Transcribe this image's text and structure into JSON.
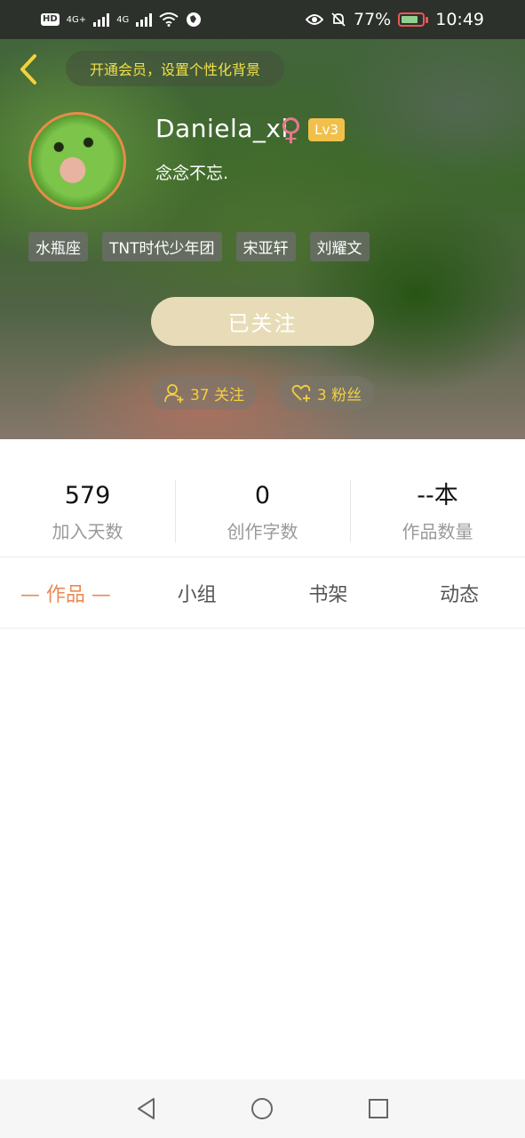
{
  "status_bar": {
    "hd_label": "HD",
    "sim1": "4G+",
    "sim2": "4G",
    "battery": "77%",
    "time": "10:49"
  },
  "header": {
    "vip_promo": "开通会员，设置个性化背景",
    "username": "Daniela_xi",
    "gender_symbol": "♀",
    "level": "Lv3",
    "signature": "念念不忘.",
    "tags": [
      "水瓶座",
      "TNT时代少年团",
      "宋亚轩",
      "刘耀文"
    ],
    "follow_button": "已关注",
    "following_count": "37 关注",
    "fans_count": "3 粉丝"
  },
  "stats": [
    {
      "value": "579",
      "label": "加入天数"
    },
    {
      "value": "0",
      "label": "创作字数"
    },
    {
      "value": "--本",
      "label": "作品数量"
    }
  ],
  "tabs": [
    "— 作品 —",
    "小组",
    "书架",
    "动态"
  ],
  "colors": {
    "accent": "#ea8a54",
    "level_badge": "#f1c04b",
    "follow_button": "#e7dcb7",
    "pill_text": "#f3cf3f"
  }
}
